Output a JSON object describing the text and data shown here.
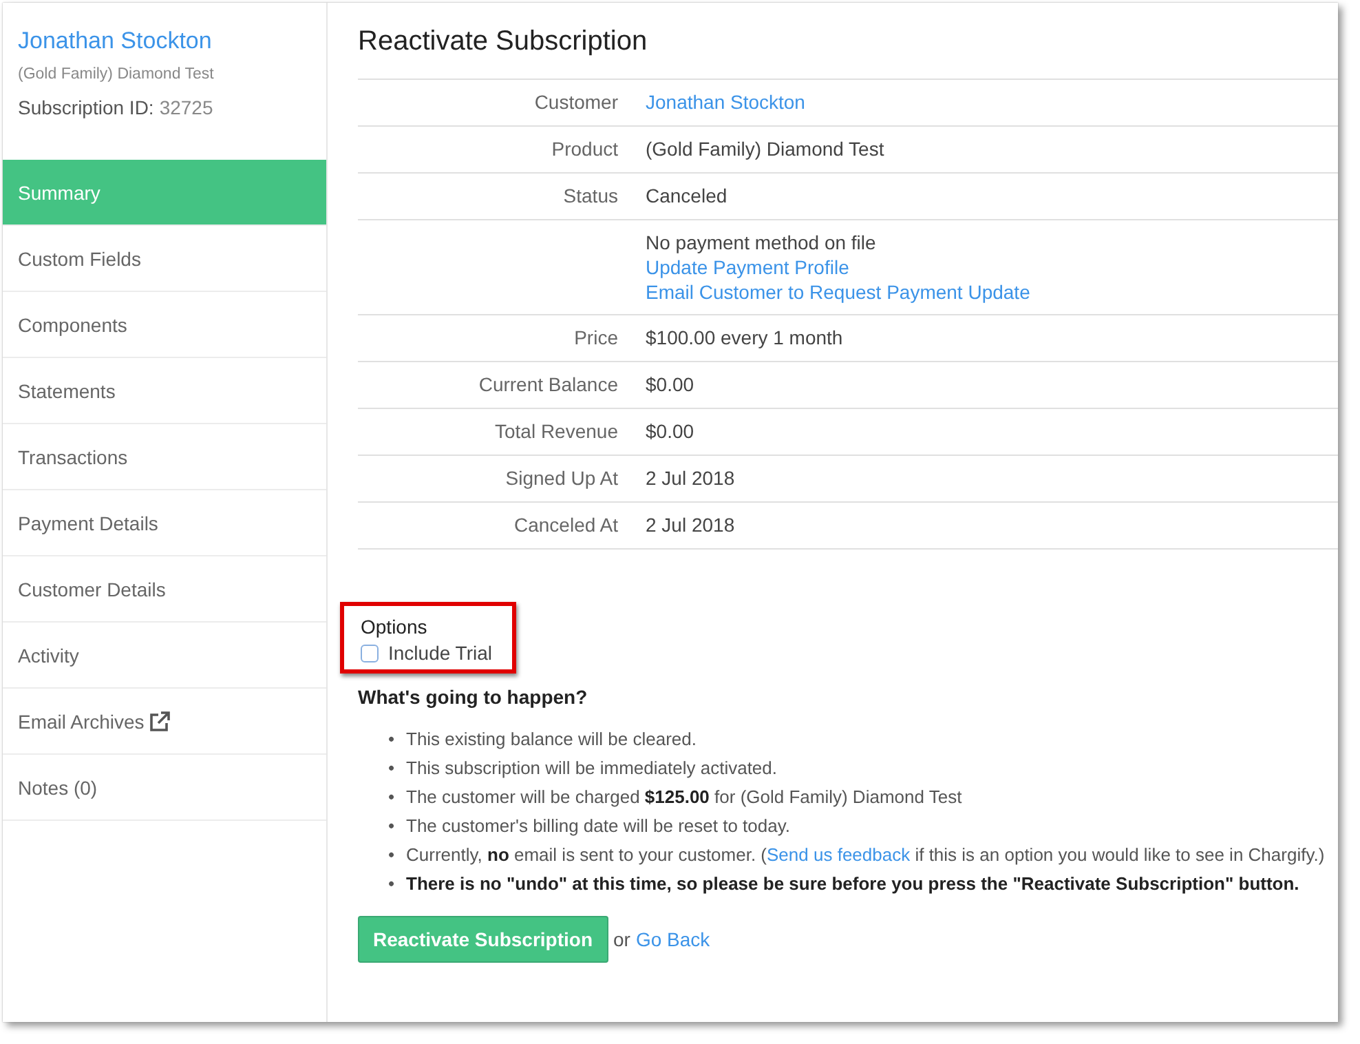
{
  "sidebar": {
    "customer_name": "Jonathan Stockton",
    "product": "(Gold Family) Diamond Test",
    "subscription_id_label": "Subscription ID:",
    "subscription_id": "32725",
    "items": [
      {
        "label": "Summary",
        "selected": true
      },
      {
        "label": "Custom Fields",
        "selected": false
      },
      {
        "label": "Components",
        "selected": false
      },
      {
        "label": "Statements",
        "selected": false
      },
      {
        "label": "Transactions",
        "selected": false
      },
      {
        "label": "Payment Details",
        "selected": false
      },
      {
        "label": "Customer Details",
        "selected": false
      },
      {
        "label": "Activity",
        "selected": false
      },
      {
        "label": "Email Archives",
        "selected": false,
        "external": true
      },
      {
        "label": "Notes (0)",
        "selected": false
      }
    ]
  },
  "title": "Reactivate Subscription",
  "details": [
    {
      "label": "Customer",
      "lines": [
        {
          "text": "Jonathan Stockton",
          "kind": "link"
        }
      ]
    },
    {
      "label": "Product",
      "lines": [
        {
          "text": "(Gold Family) Diamond Test",
          "kind": "text"
        }
      ]
    },
    {
      "label": "Status",
      "lines": [
        {
          "text": "Canceled",
          "kind": "text"
        }
      ]
    },
    {
      "lines": [
        {
          "text": "No payment method on file",
          "kind": "text"
        },
        {
          "text": "Update Payment Profile",
          "kind": "link"
        },
        {
          "text": "Email Customer to Request Payment Update",
          "kind": "link"
        }
      ]
    },
    {
      "label": "Price",
      "lines": [
        {
          "text": "$100.00 every 1 month",
          "kind": "text"
        }
      ]
    },
    {
      "label": "Current Balance",
      "lines": [
        {
          "text": "$0.00",
          "kind": "text"
        }
      ]
    },
    {
      "label": "Total Revenue",
      "lines": [
        {
          "text": "$0.00",
          "kind": "text"
        }
      ]
    },
    {
      "label": "Signed Up At",
      "lines": [
        {
          "text": "2 Jul 2018",
          "kind": "text"
        }
      ]
    },
    {
      "label": "Canceled At",
      "lines": [
        {
          "text": "2 Jul 2018",
          "kind": "text"
        }
      ]
    }
  ],
  "options": {
    "heading": "Options",
    "highlighted": true,
    "checkbox": {
      "label": "Include Trial",
      "checked": false
    }
  },
  "happen_heading": "What's going to happen?",
  "bullets": [
    {
      "marker": "•",
      "emphasis": false,
      "parts": [
        {
          "kind": "text",
          "text": "This existing balance will be cleared."
        }
      ]
    },
    {
      "marker": "•",
      "emphasis": false,
      "parts": [
        {
          "kind": "text",
          "text": "This subscription will be immediately activated."
        }
      ]
    },
    {
      "marker": "•",
      "emphasis": false,
      "parts": [
        {
          "kind": "text",
          "text": "The customer will be charged **$125.00** for (Gold Family) Diamond Test"
        }
      ]
    },
    {
      "marker": "•",
      "emphasis": false,
      "parts": [
        {
          "kind": "text",
          "text": "The customer's billing date will be reset to today."
        }
      ]
    },
    {
      "marker": "•",
      "emphasis": false,
      "parts": [
        {
          "kind": "text",
          "text": "Currently, **no** email is sent to your customer. ("
        },
        {
          "kind": "link",
          "text": "Send us feedback"
        },
        {
          "kind": "text",
          "text": " if this is an option you would like to see in Chargify.)"
        }
      ]
    },
    {
      "marker": "•",
      "emphasis": true,
      "parts": [
        {
          "kind": "text",
          "text": "There is no \"undo\" at this time, so please be sure before you press the \"Reactivate Subscription\" button."
        }
      ]
    }
  ],
  "actions": {
    "button": "Reactivate Subscription",
    "or": "or",
    "link": "Go Back"
  }
}
